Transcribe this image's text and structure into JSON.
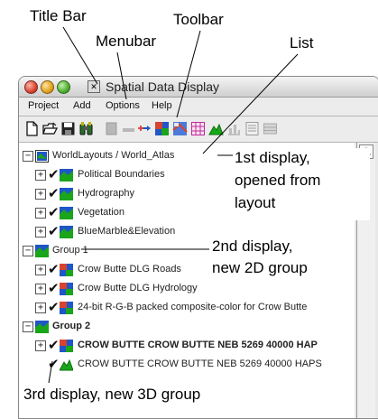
{
  "annotations": {
    "title_bar": "Title Bar",
    "menubar": "Menubar",
    "toolbar": "Toolbar",
    "list": "List",
    "display1_line1": "1st display,",
    "display1_line2": "opened from",
    "display1_line3": "layout",
    "display2_line1": "2nd display,",
    "display2_line2": "new 2D group",
    "display3": "3rd display, new 3D group"
  },
  "window": {
    "title": "Spatial Data Display"
  },
  "menubar": {
    "items": [
      "Project",
      "Add",
      "Options",
      "Help"
    ]
  },
  "toolbar": {
    "icons": [
      "new-document-icon",
      "open-folder-icon",
      "save-disk-icon",
      "binoculars-icon",
      "disabled-layer-icon",
      "disabled-dash-icon",
      "add-layer-icon",
      "raster-layer-icon",
      "reprojection-icon",
      "grid-icon",
      "terrain-icon",
      "chart-icon",
      "list-icon",
      "disabled-table-icon"
    ]
  },
  "tree": {
    "world": {
      "label": "WorldLayouts / World_Atlas",
      "children": [
        "Political Boundaries",
        "Hydrography",
        "Vegetation",
        "BlueMarble&Elevation"
      ]
    },
    "group1": {
      "label": "Group 1",
      "children": [
        "Crow Butte DLG Roads",
        "Crow Butte DLG Hydrology",
        "24-bit R-G-B packed composite-color for Crow Butte"
      ]
    },
    "group2": {
      "label": "Group 2",
      "child_bold": "CROW BUTTE CROW BUTTE NEB 5269  40000 HAP",
      "child_plain": "CROW BUTTE CROW BUTTE NEB 5269  40000 HAPS"
    }
  },
  "colors": {
    "window_bg": "#e8e8e8",
    "list_bg": "#ffffff",
    "green": "#1aa51a",
    "blue": "#1f56c8",
    "red": "#d8432f"
  }
}
